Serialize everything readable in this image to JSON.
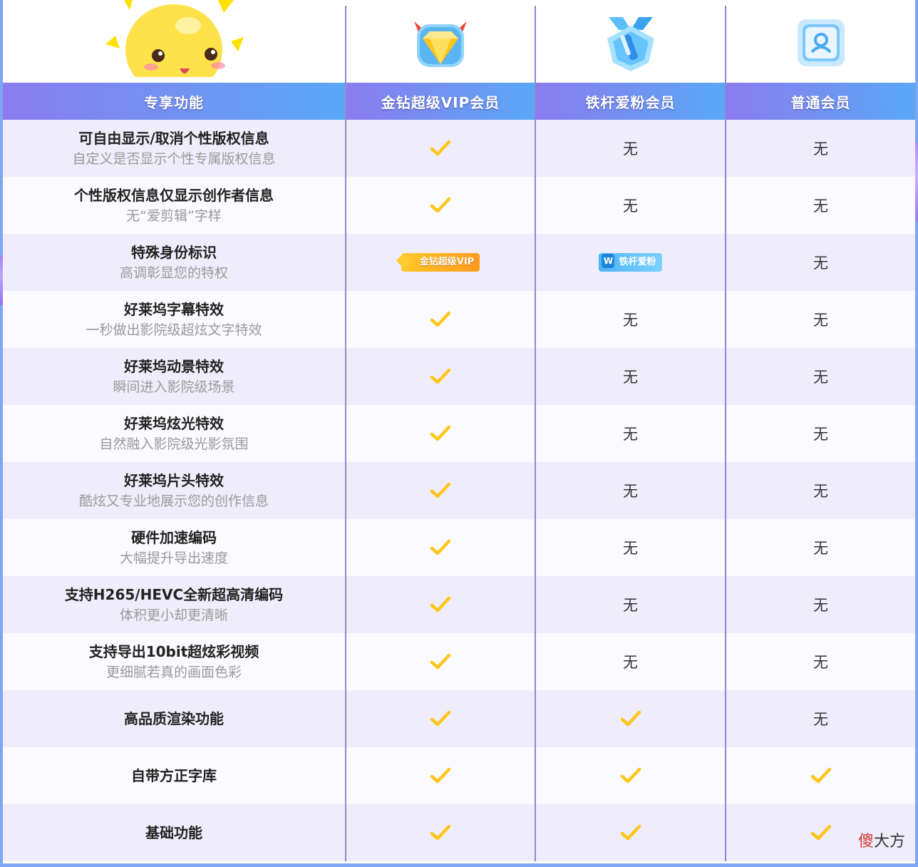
{
  "columns": [
    "专享功能",
    "金钻超级VIP会员",
    "铁杆爱粉会员",
    "普通会员"
  ],
  "badges": {
    "gold": "金钻超级VIP",
    "blue": "铁杆爱粉"
  },
  "values": {
    "none": "无"
  },
  "rows": [
    {
      "name": "可自由显示/取消个性版权信息",
      "desc": "自定义是否显示个性专属版权信息",
      "vip": "check",
      "fan": "无",
      "normal": "无"
    },
    {
      "name": "个性版权信息仅显示创作者信息",
      "desc": "无“爱剪辑”字样",
      "vip": "check",
      "fan": "无",
      "normal": "无"
    },
    {
      "name": "特殊身份标识",
      "desc": "高调彰显您的特权",
      "vip": "badge-gold",
      "fan": "badge-blue",
      "normal": "无"
    },
    {
      "name": "好莱坞字幕特效",
      "desc": "一秒做出影院级超炫文字特效",
      "vip": "check",
      "fan": "无",
      "normal": "无"
    },
    {
      "name": "好莱坞动景特效",
      "desc": "瞬间进入影院级场景",
      "vip": "check",
      "fan": "无",
      "normal": "无"
    },
    {
      "name": "好莱坞炫光特效",
      "desc": "自然融入影院级光影氛围",
      "vip": "check",
      "fan": "无",
      "normal": "无"
    },
    {
      "name": "好莱坞片头特效",
      "desc": "酷炫又专业地展示您的创作信息",
      "vip": "check",
      "fan": "无",
      "normal": "无"
    },
    {
      "name": "硬件加速编码",
      "desc": "大幅提升导出速度",
      "vip": "check",
      "fan": "无",
      "normal": "无"
    },
    {
      "name": "支持H265/HEVC全新超高清编码",
      "desc": "体积更小却更清晰",
      "vip": "check",
      "fan": "无",
      "normal": "无"
    },
    {
      "name": "支持导出10bit超炫彩视频",
      "desc": "更细腻若真的画面色彩",
      "vip": "check",
      "fan": "无",
      "normal": "无"
    },
    {
      "name": "高品质渲染功能",
      "desc": "",
      "vip": "check",
      "fan": "check",
      "normal": "无"
    },
    {
      "name": "自带方正字库",
      "desc": "",
      "vip": "check",
      "fan": "check",
      "normal": "check"
    },
    {
      "name": "基础功能",
      "desc": "",
      "vip": "check",
      "fan": "check",
      "normal": "check"
    }
  ],
  "icons": [
    "sun-mascot-icon",
    "gold-diamond-vip-icon",
    "blue-fan-medal-icon",
    "normal-member-icon"
  ],
  "colors": {
    "header_start": "#8b7cf0",
    "header_end": "#5aa8f5",
    "check": "#ffc61a",
    "row_alt": "#efedfb",
    "border": "#8f86d6"
  },
  "watermark": {
    "red": "傻",
    "rest": "大方"
  }
}
